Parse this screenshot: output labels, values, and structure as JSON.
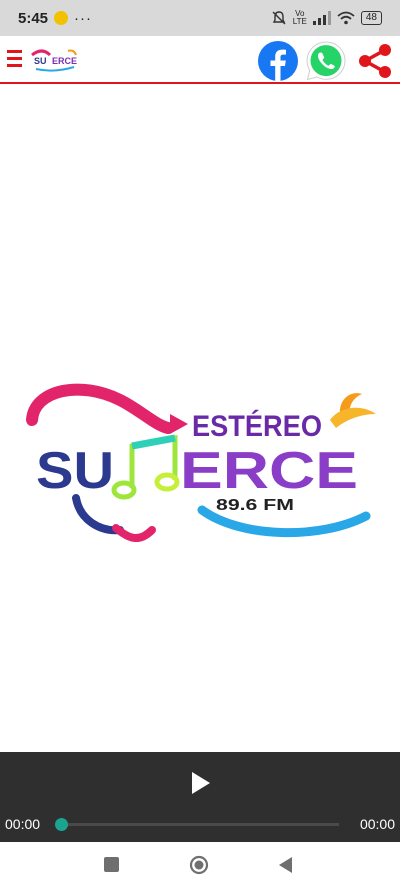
{
  "status_bar": {
    "time": "5:45",
    "dots": "···",
    "volte_label_1": "Vo",
    "volte_label_2": "LTE",
    "battery": "48",
    "icons": [
      "notification-icon",
      "mute-icon",
      "volte-icon",
      "signal-icon",
      "wifi-icon",
      "battery-icon"
    ]
  },
  "app_bar": {
    "accent_color": "#e0161b",
    "icons": [
      "menu-icon",
      "facebook-icon",
      "whatsapp-icon",
      "share-icon"
    ]
  },
  "logo": {
    "estereo": "ESTÉREO",
    "su": "SU",
    "erce": "ERCE",
    "frequency": "89.6 FM"
  },
  "player": {
    "elapsed": "00:00",
    "duration": "00:00",
    "progress": 0,
    "accent_color": "#1ba48f",
    "background": "#2f2f2f"
  },
  "nav_bar": {
    "icons": [
      "recents-icon",
      "home-icon",
      "back-icon"
    ]
  }
}
